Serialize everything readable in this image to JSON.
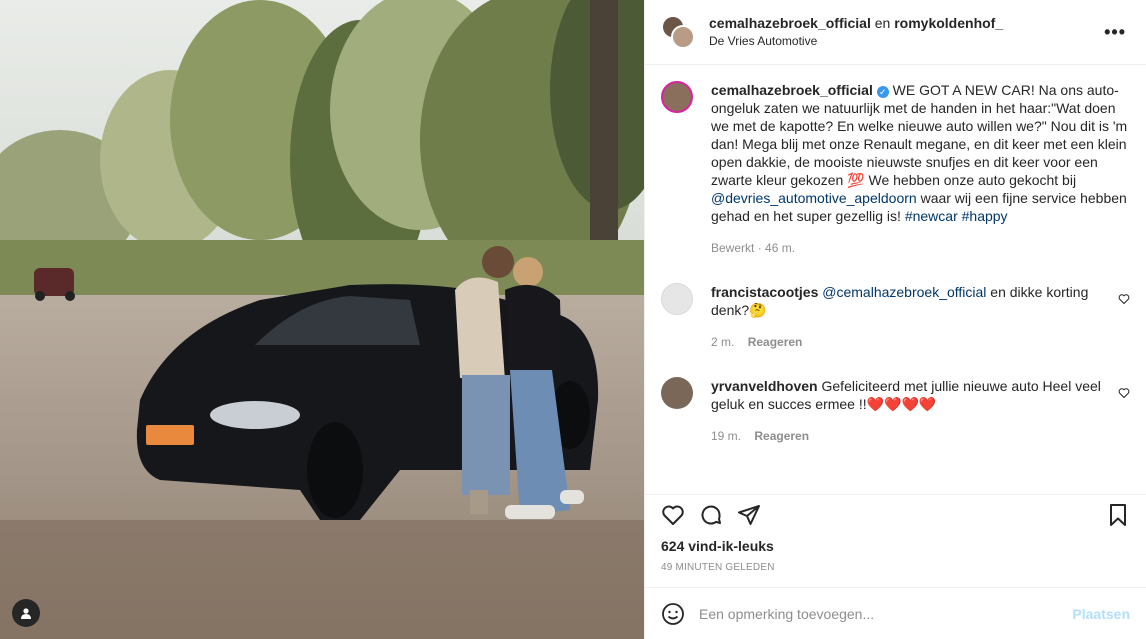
{
  "header": {
    "user1": "cemalhazebroek_official",
    "connector": "en",
    "user2": "romykoldenhof_",
    "location": "De Vries Automotive",
    "more": "•••"
  },
  "caption": {
    "username": "cemalhazebroek_official",
    "text1": " WE GOT A NEW CAR! Na ons auto-ongeluk zaten we natuurlijk met de handen in het haar:\"Wat doen we met de kapotte? En welke nieuwe auto willen we?\" Nou dit is 'm dan! Mega blij met onze Renault megane, en dit keer met een klein open dakkie, de mooiste nieuwste snufjes en dit keer voor een zwarte kleur gekozen 💯 We hebben onze auto gekocht bij ",
    "mention": "@devries_automotive_apeldoorn",
    "text2": " waar wij een fijne service hebben gehad en het super gezellig is! ",
    "tag1": "#newcar",
    "tag2": "#happy",
    "edited": "Bewerkt",
    "time": "46 m."
  },
  "comments": [
    {
      "username": "francistacootjes",
      "mention": "@cemalhazebroek_official",
      "text": " en dikke korting denk?🤔",
      "time": "2 m.",
      "reply": "Reageren"
    },
    {
      "username": "yrvanveldhoven",
      "mention": "",
      "text": " Gefeliciteerd met jullie nieuwe auto Heel veel geluk en succes ermee !!❤️❤️❤️❤️",
      "time": "19 m.",
      "reply": "Reageren"
    }
  ],
  "likes": "624 vind-ik-leuks",
  "posted": "49 MINUTEN GELEDEN",
  "add_comment": {
    "placeholder": "Een opmerking toevoegen...",
    "post": "Plaatsen"
  },
  "icons": {
    "like": "heart-icon",
    "comment": "comment-icon",
    "share": "paper-plane-icon",
    "save": "bookmark-icon",
    "emoji": "emoji-icon",
    "tag": "user-tag-icon"
  },
  "colors": {
    "link": "#00376b",
    "verified": "#3897f0",
    "post_btn": "#b2dffc",
    "meta": "#8e8e8e"
  }
}
